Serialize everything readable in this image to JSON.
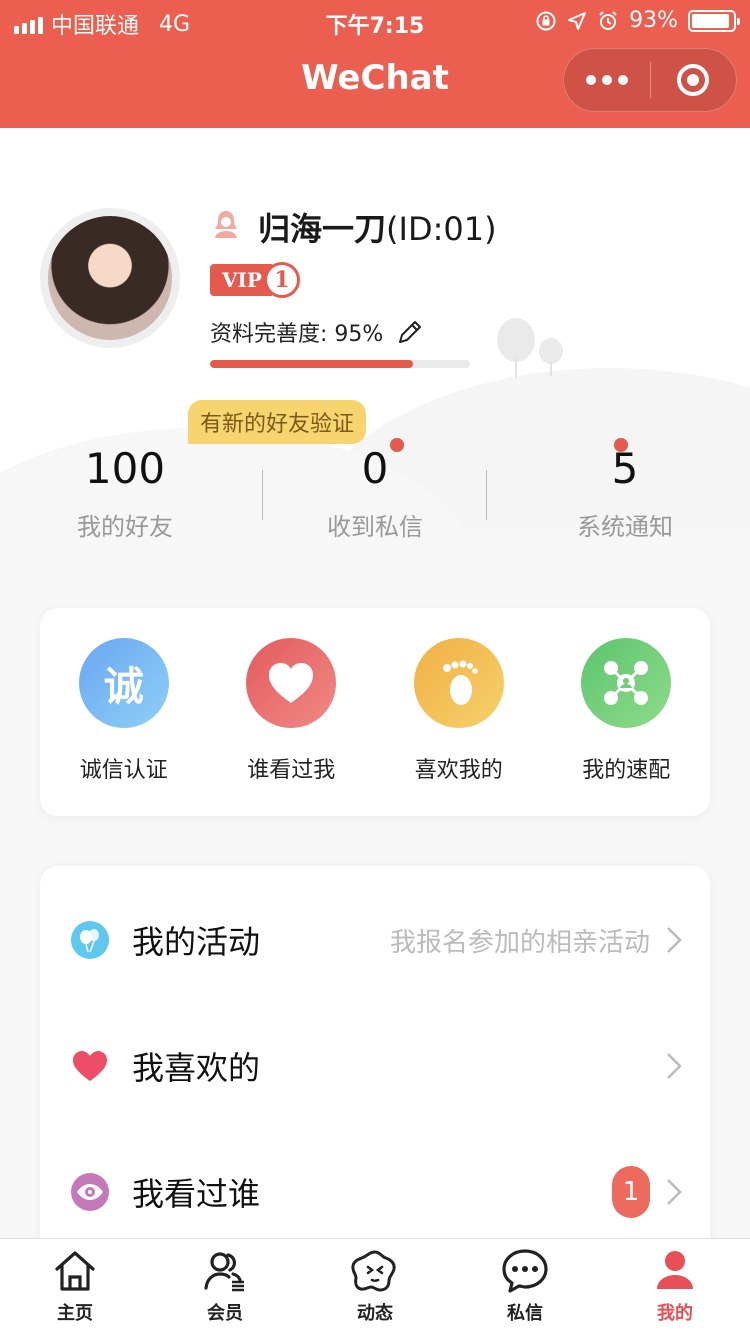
{
  "status_bar": {
    "carrier": "中国联通",
    "network": "4G",
    "time": "下午7:15",
    "battery": "93%",
    "battery_level": 0.93
  },
  "nav": {
    "title": "WeChat"
  },
  "profile": {
    "username": "归海一刀",
    "user_id": "(ID:01)",
    "vip_label": "VIP",
    "vip_level": "1",
    "completion_label": "资料完善度:",
    "completion_value": "95%",
    "completion_fraction": 0.78,
    "friend_request_bubble": "有新的好友验证"
  },
  "stats": [
    {
      "value": "100",
      "label": "我的好友",
      "has_dot": false
    },
    {
      "value": "0",
      "label": "收到私信",
      "has_dot": true
    },
    {
      "value": "5",
      "label": "系统通知",
      "has_dot": true
    }
  ],
  "actions": [
    {
      "label": "诚信认证",
      "icon": "verify-icon",
      "glyph": "诚"
    },
    {
      "label": "谁看过我",
      "icon": "heart-icon"
    },
    {
      "label": "喜欢我的",
      "icon": "footprint-icon"
    },
    {
      "label": "我的速配",
      "icon": "match-icon"
    }
  ],
  "menu": [
    {
      "title": "我的活动",
      "subtitle": "我报名参加的相亲活动",
      "icon": "balloon-icon"
    },
    {
      "title": "我喜欢的",
      "subtitle": "",
      "icon": "heart-icon"
    },
    {
      "title": "我看过谁",
      "badge": "1",
      "icon": "eye-icon"
    }
  ],
  "tabs": [
    {
      "label": "主页",
      "icon": "home-icon",
      "active": false
    },
    {
      "label": "会员",
      "icon": "members-icon",
      "active": false
    },
    {
      "label": "动态",
      "icon": "moments-icon",
      "active": false
    },
    {
      "label": "私信",
      "icon": "chat-icon",
      "active": false
    },
    {
      "label": "我的",
      "icon": "profile-icon",
      "active": true
    }
  ],
  "colors": {
    "brand": "#ec5e50",
    "accent": "#e55a4c",
    "tab_active": "#e94f56",
    "bubble": "#f7d46e"
  }
}
